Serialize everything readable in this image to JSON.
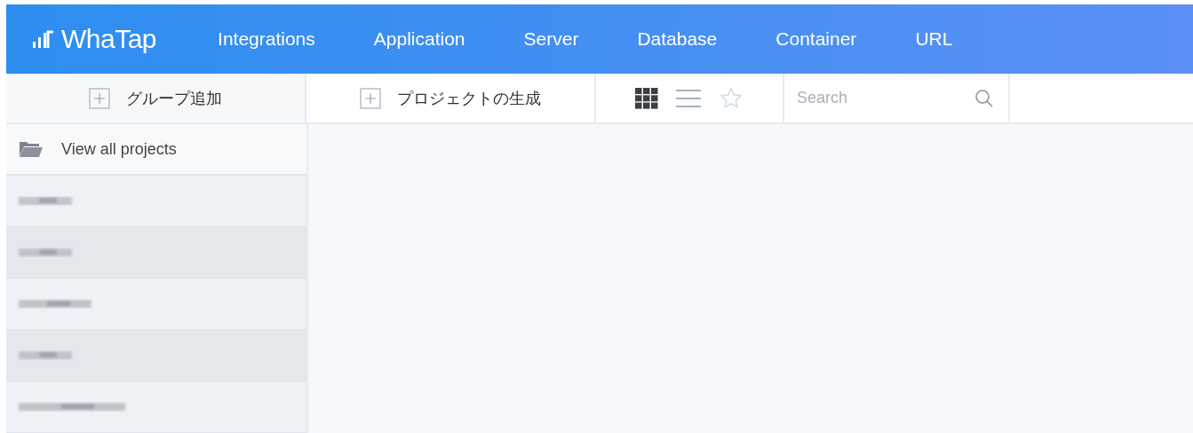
{
  "logo": {
    "text": "WhaTap"
  },
  "nav": [
    {
      "label": "Integrations"
    },
    {
      "label": "Application"
    },
    {
      "label": "Server"
    },
    {
      "label": "Database"
    },
    {
      "label": "Container"
    },
    {
      "label": "URL"
    }
  ],
  "add_group": {
    "label": "グループ追加"
  },
  "create_project": {
    "label": "プロジェクトの生成"
  },
  "view_modes": [
    {
      "kind": "grid",
      "selected": true
    },
    {
      "kind": "list",
      "selected": false
    },
    {
      "kind": "favorites",
      "selected": false
    }
  ],
  "search": {
    "placeholder": "Search"
  },
  "sidebar": {
    "all_projects": {
      "label": "View all projects"
    },
    "groups": [
      {
        "kind": "redacted"
      },
      {
        "kind": "redacted"
      },
      {
        "kind": "redacted"
      },
      {
        "kind": "redacted"
      },
      {
        "kind": "redacted"
      }
    ]
  }
}
